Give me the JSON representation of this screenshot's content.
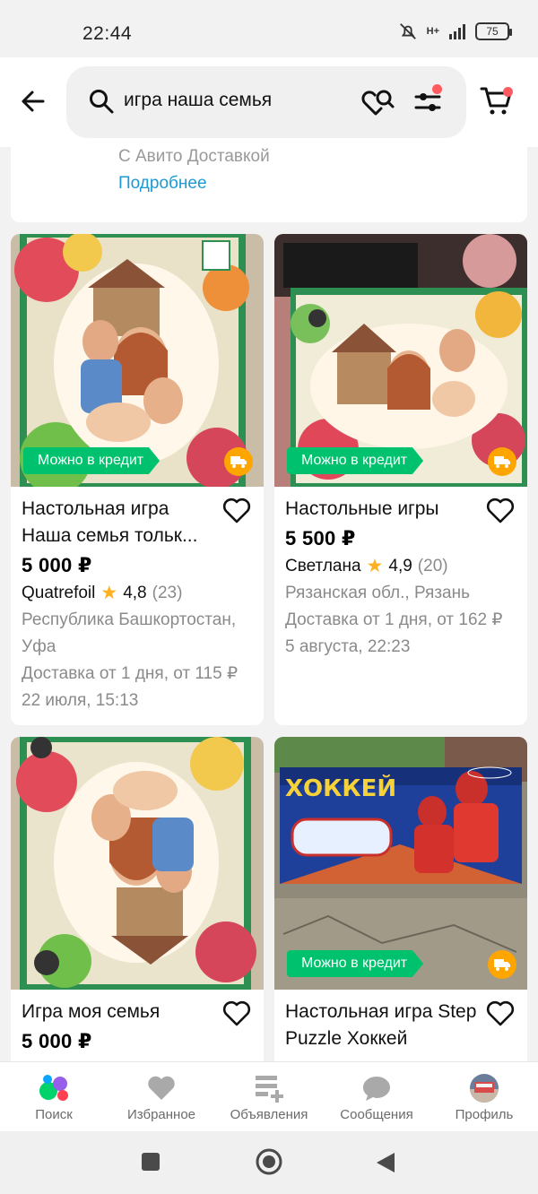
{
  "status_bar": {
    "time": "22:44",
    "network": "H+",
    "battery": "75"
  },
  "search": {
    "query": "игра наша семья"
  },
  "promo": {
    "text": "С Авито Доставкой",
    "link": "Подробнее"
  },
  "badge_credit": "Можно в кредит",
  "listings": [
    {
      "title": "Настольная игра Наша семья тольк...",
      "price": "5 000 ₽",
      "seller": "Quatrefoil",
      "rating": "4,8",
      "reviews": "(23)",
      "location": "Республика Башкортостан, Уфа",
      "delivery": "Доставка от 1 дня, от 115 ₽",
      "date": "22 июля, 15:13"
    },
    {
      "title": "Настольные игры",
      "price": "5 500 ₽",
      "seller": "Светлана",
      "rating": "4,9",
      "reviews": "(20)",
      "location": "Рязанская обл., Рязань",
      "delivery": "Доставка от 1 дня, от 162 ₽",
      "date": "5 августа, 22:23"
    },
    {
      "title": "Игра моя семья",
      "price": "5 000 ₽"
    },
    {
      "title": "Настольная игра Step Puzzle Хоккей"
    }
  ],
  "bottom_nav": [
    {
      "label": "Поиск",
      "icon": "avito-logo-icon"
    },
    {
      "label": "Избранное",
      "icon": "heart-icon"
    },
    {
      "label": "Объявления",
      "icon": "listings-add-icon"
    },
    {
      "label": "Сообщения",
      "icon": "chat-bubble-icon"
    },
    {
      "label": "Профиль",
      "icon": "profile-avatar-icon"
    }
  ],
  "colors": {
    "accent_green": "#00c26e",
    "link_blue": "#1a9ad6",
    "notification_red": "#ff5a5f",
    "delivery_orange": "#ffa500"
  }
}
